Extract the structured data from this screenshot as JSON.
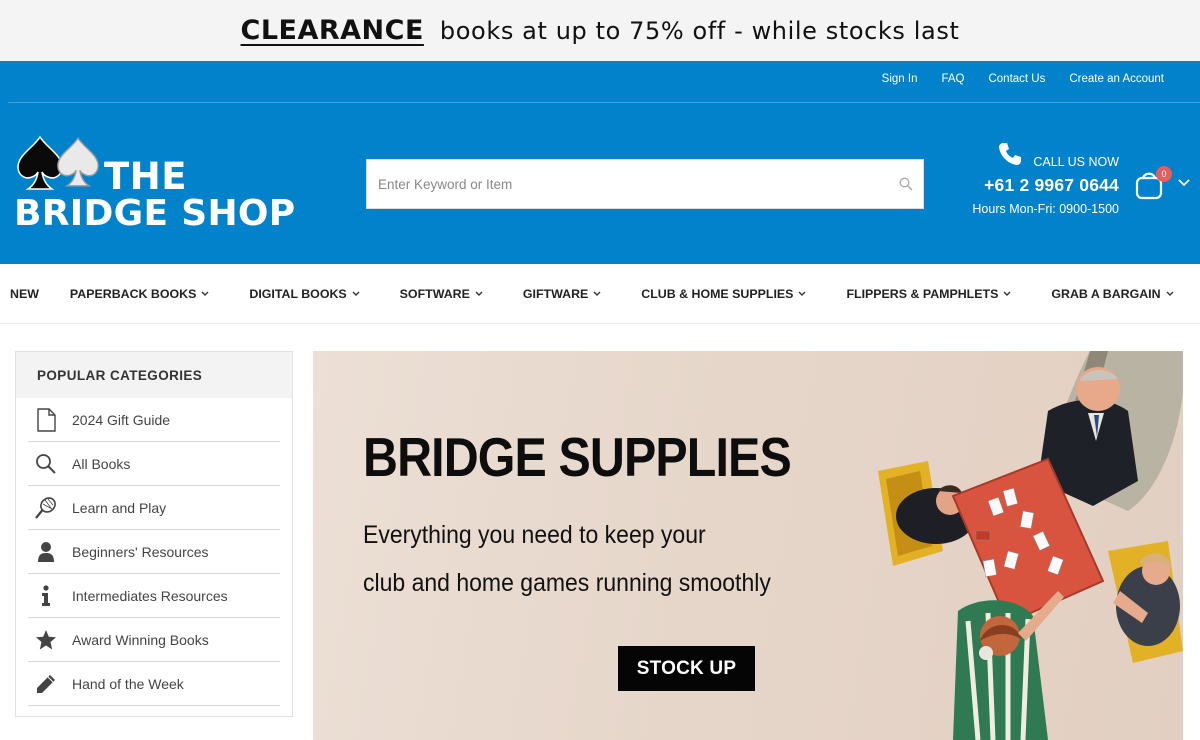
{
  "promo": {
    "strong": "CLEARANCE",
    "text": "books at up to 75% off - while stocks last"
  },
  "header": {
    "toplinks": [
      "Sign In",
      "FAQ",
      "Contact Us",
      "Create an Account"
    ],
    "logo": {
      "line1": "THE",
      "line2": "BRIDGE SHOP"
    },
    "search": {
      "placeholder": "Enter Keyword or Item",
      "value": ""
    },
    "contact": {
      "call_label": "CALL US NOW",
      "phone": "+61 2 9967 0644",
      "hours": "Hours Mon-Fri: 0900-1500"
    },
    "cart": {
      "count": "0"
    },
    "colors": {
      "brand": "#0382cc",
      "badge": "#e85c5c"
    }
  },
  "nav": {
    "items": [
      {
        "label": "NEW",
        "dropdown": false
      },
      {
        "label": "PAPERBACK BOOKS",
        "dropdown": true
      },
      {
        "label": "DIGITAL BOOKS",
        "dropdown": true
      },
      {
        "label": "SOFTWARE",
        "dropdown": true
      },
      {
        "label": "GIFTWARE",
        "dropdown": true
      },
      {
        "label": "CLUB & HOME SUPPLIES",
        "dropdown": true
      },
      {
        "label": "FLIPPERS & PAMPHLETS",
        "dropdown": true
      },
      {
        "label": "GRAB A BARGAIN",
        "dropdown": true
      }
    ]
  },
  "sidebar": {
    "title": "POPULAR CATEGORIES",
    "items": [
      {
        "label": "2024 Gift Guide",
        "icon": "document-icon"
      },
      {
        "label": "All Books",
        "icon": "search-icon"
      },
      {
        "label": "Learn and Play",
        "icon": "tennis-racket-icon"
      },
      {
        "label": "Beginners' Resources",
        "icon": "user-icon"
      },
      {
        "label": "Intermediates Resources",
        "icon": "info-icon"
      },
      {
        "label": "Award Winning Books",
        "icon": "star-icon"
      },
      {
        "label": "Hand of the Week",
        "icon": "pencil-icon"
      }
    ]
  },
  "banner": {
    "title": "BRIDGE SUPPLIES",
    "subtitle_line1": "Everything you need to keep your",
    "subtitle_line2": "club and home games running smoothly",
    "button": "STOCK UP"
  }
}
